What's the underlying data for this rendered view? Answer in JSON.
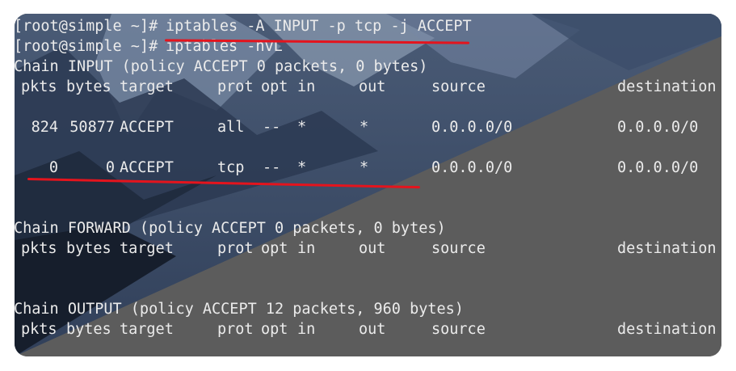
{
  "terminal": {
    "colors": {
      "text": "#ebebeb",
      "annotation": "#e4141d"
    },
    "commands": [
      {
        "prompt": "[root@simple ~]#",
        "command": "iptables -A INPUT -p tcp -j ACCEPT"
      },
      {
        "prompt": "[root@simple ~]#",
        "command": "iptables -nvL"
      }
    ],
    "columns": {
      "pkts": "pkts",
      "bytes": "bytes",
      "target": "target",
      "prot": "prot",
      "opt": "opt",
      "in": "in",
      "out": "out",
      "source": "source",
      "destination": "destination"
    },
    "chains": [
      {
        "header": "Chain INPUT (policy ACCEPT 0 packets, 0 bytes)",
        "rules": [
          {
            "pkts": "824",
            "bytes": "50877",
            "target": "ACCEPT",
            "prot": "all",
            "opt": "--",
            "in": "*",
            "out": "*",
            "source": "0.0.0.0/0",
            "destination": "0.0.0.0/0"
          },
          {
            "pkts": "0",
            "bytes": "0",
            "target": "ACCEPT",
            "prot": "tcp",
            "opt": "--",
            "in": "*",
            "out": "*",
            "source": "0.0.0.0/0",
            "destination": "0.0.0.0/0"
          }
        ]
      },
      {
        "header": "Chain FORWARD (policy ACCEPT 0 packets, 0 bytes)",
        "rules": []
      },
      {
        "header": "Chain OUTPUT (policy ACCEPT 12 packets, 960 bytes)",
        "rules": []
      }
    ]
  }
}
